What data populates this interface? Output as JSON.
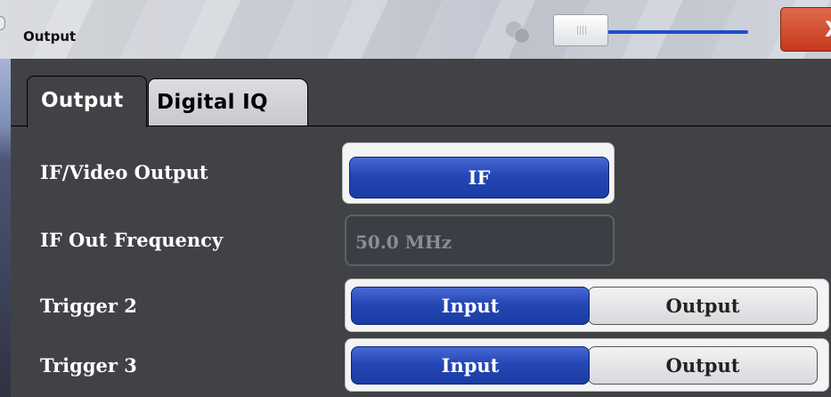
{
  "window": {
    "title": "Output",
    "close_glyph": "X"
  },
  "tabs": [
    {
      "label": "Output",
      "active": true
    },
    {
      "label": "Digital IQ",
      "active": false
    }
  ],
  "rows": {
    "if_video_output": {
      "label": "IF/Video Output",
      "value": "IF"
    },
    "if_out_frequency": {
      "label": "IF Out Frequency",
      "value": "50.0 MHz"
    },
    "trigger2": {
      "label": "Trigger 2",
      "options": [
        "Input",
        "Output"
      ],
      "selected": "Input"
    },
    "trigger3": {
      "label": "Trigger 3",
      "options": [
        "Input",
        "Output"
      ],
      "selected": "Input"
    }
  },
  "icons": [
    "circles-icon",
    "slider",
    "close-icon"
  ],
  "colors": {
    "accent": "#2447b4",
    "close": "#c5381c",
    "panel": "#414246"
  }
}
